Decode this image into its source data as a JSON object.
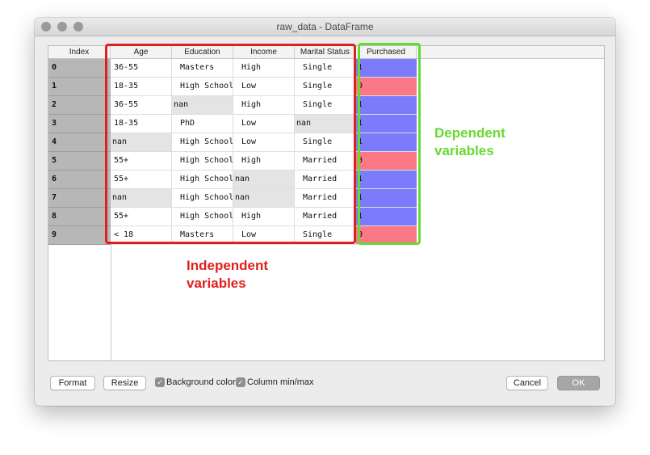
{
  "window": {
    "title": "raw_data - DataFrame"
  },
  "table": {
    "index_header": "Index",
    "columns": [
      "Age",
      "Education",
      "Income",
      "Marital Status",
      "Purchased"
    ],
    "rows": [
      {
        "index": "0",
        "age": "36-55",
        "education": "Masters",
        "income": "High",
        "marital": "Single",
        "purchased": "1"
      },
      {
        "index": "1",
        "age": "18-35",
        "education": "High School",
        "income": "Low",
        "marital": "Single",
        "purchased": "0"
      },
      {
        "index": "2",
        "age": "36-55",
        "education": "nan",
        "income": "High",
        "marital": "Single",
        "purchased": "1"
      },
      {
        "index": "3",
        "age": "18-35",
        "education": "PhD",
        "income": "Low",
        "marital": "nan",
        "purchased": "1"
      },
      {
        "index": "4",
        "age": "nan",
        "education": "High School",
        "income": "Low",
        "marital": "Single",
        "purchased": "1"
      },
      {
        "index": "5",
        "age": "55+",
        "education": "High School",
        "income": "High",
        "marital": "Married",
        "purchased": "0"
      },
      {
        "index": "6",
        "age": "55+",
        "education": "High School",
        "income": "nan",
        "marital": "Married",
        "purchased": "1"
      },
      {
        "index": "7",
        "age": "nan",
        "education": "High School",
        "income": "nan",
        "marital": "Married",
        "purchased": "1"
      },
      {
        "index": "8",
        "age": "55+",
        "education": "High School",
        "income": "High",
        "marital": "Married",
        "purchased": "1"
      },
      {
        "index": "9",
        "age": "< 18",
        "education": "Masters",
        "income": "Low",
        "marital": "Single",
        "purchased": "0"
      }
    ]
  },
  "annotations": {
    "independent": [
      "Independent",
      "variables"
    ],
    "dependent": [
      "Dependent",
      "variables"
    ]
  },
  "buttons": {
    "format": "Format",
    "resize": "Resize",
    "cancel": "Cancel",
    "ok": "OK"
  },
  "checkboxes": {
    "background_color": {
      "label": "Background color",
      "checked": true
    },
    "column_minmax": {
      "label": "Column min/max",
      "checked": true
    }
  },
  "colors": {
    "purchased_one": "#7b7bfc",
    "purchased_zero": "#fb7886",
    "independent_box": "#e0201f",
    "dependent_box": "#68d930"
  }
}
